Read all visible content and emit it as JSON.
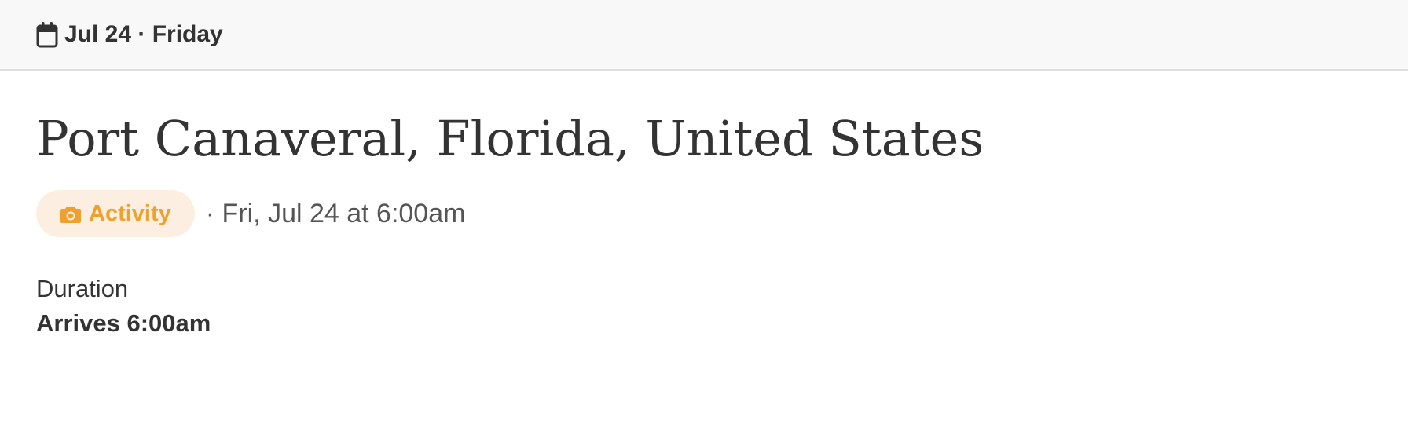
{
  "header": {
    "icon": "calendar-icon",
    "date_label": "Jul 24 · Friday"
  },
  "event": {
    "title": "Port Canaveral, Florida, United States",
    "badge": {
      "icon": "camera-icon",
      "label": "Activity",
      "text_color": "#f0a02e",
      "background_color": "#fcefe1"
    },
    "when": "· Fri, Jul 24 at 6:00am",
    "duration_label": "Duration",
    "duration_value": "Arrives 6:00am"
  }
}
